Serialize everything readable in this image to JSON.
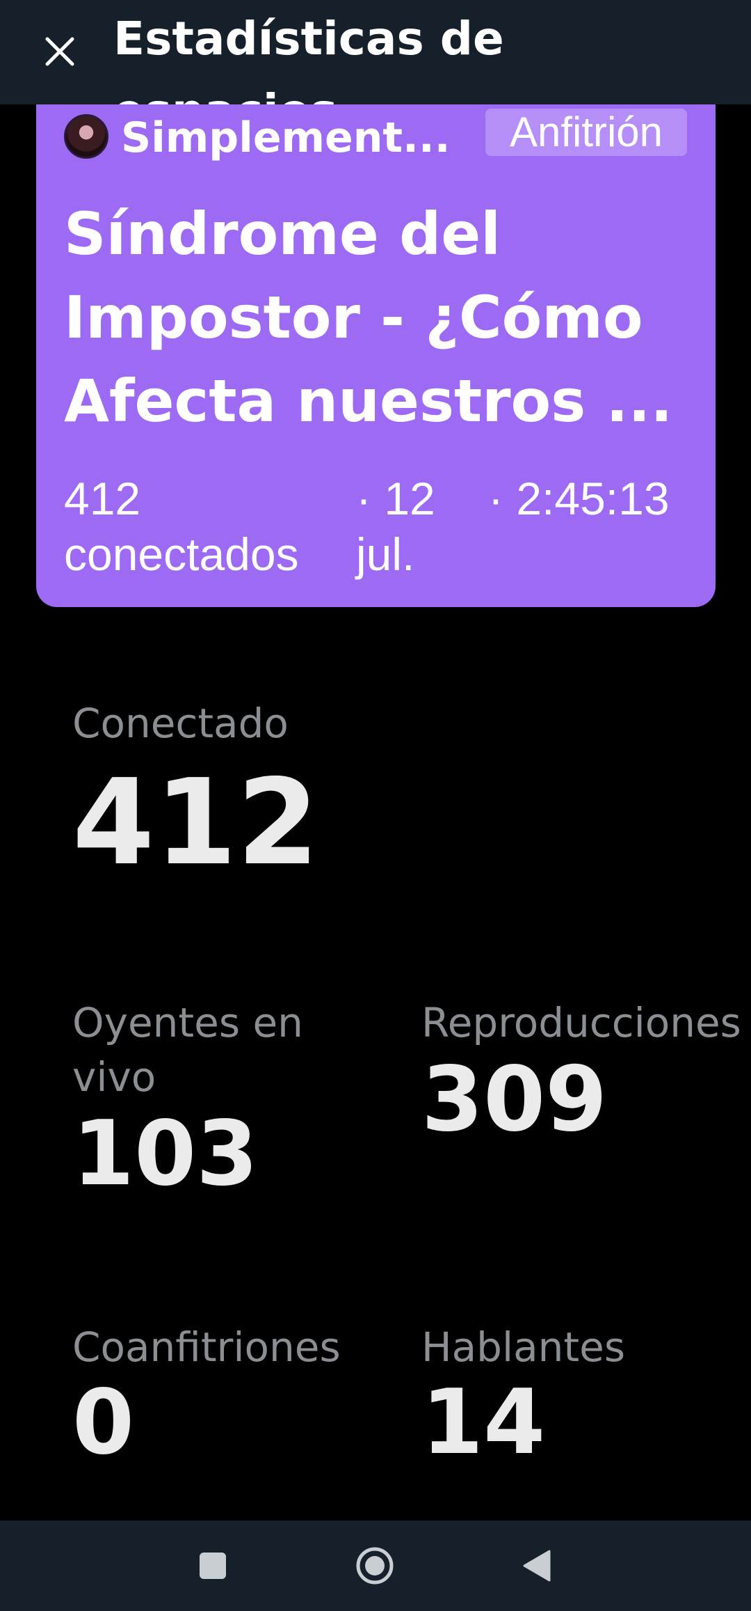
{
  "header": {
    "title": "Estadísticas de espacios"
  },
  "space": {
    "host_name": "Simplement...",
    "host_badge": "Anfitrión",
    "title": "Síndrome del Impostor - ¿Cómo Afecta nuestros ...",
    "connected": "412 conectados",
    "date": "· 12 jul.",
    "duration": "· 2:45:13"
  },
  "stats": {
    "connected": {
      "label": "Conectado",
      "value": "412"
    },
    "live_listeners": {
      "label": "Oyentes en vivo",
      "value": "103"
    },
    "replays": {
      "label": "Reproducciones de grabaciones",
      "value": "309"
    },
    "cohosts": {
      "label": "Coanfitriones",
      "value": "0"
    },
    "speakers": {
      "label": "Hablantes",
      "value": "14"
    }
  },
  "icons": {
    "close": "close-icon",
    "avatar": "avatar",
    "recents": "square-icon",
    "home": "circle-icon",
    "back": "triangle-back-icon"
  },
  "colors": {
    "topbar": "#15202b",
    "card": "#9d6af4",
    "background": "#000000",
    "label": "#8b8f94"
  }
}
